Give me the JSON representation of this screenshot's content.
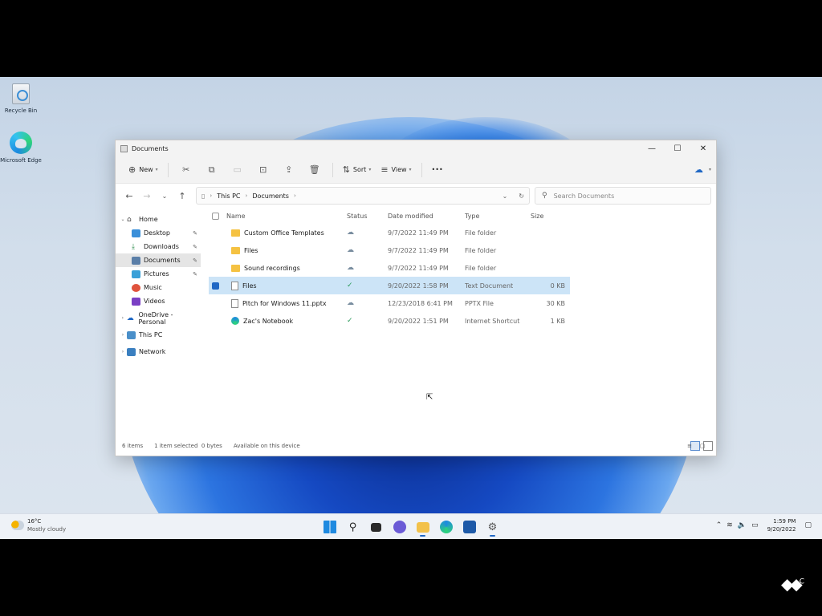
{
  "desktop": {
    "icons": [
      {
        "label": "Recycle Bin",
        "icon": "recycle-bin-icon"
      },
      {
        "label": "Microsoft Edge",
        "icon": "edge-icon"
      }
    ]
  },
  "window": {
    "title": "Documents",
    "toolbar": {
      "new_label": "New",
      "sort_label": "Sort",
      "view_label": "View",
      "more_label": "•••"
    },
    "address": {
      "crumbs": [
        "This PC",
        "Documents"
      ]
    },
    "search_placeholder": "Search Documents",
    "nav": {
      "items": [
        {
          "label": "Home"
        },
        {
          "label": "Desktop"
        },
        {
          "label": "Downloads"
        },
        {
          "label": "Documents"
        },
        {
          "label": "Pictures"
        },
        {
          "label": "Music"
        },
        {
          "label": "Videos"
        },
        {
          "label": "OneDrive - Personal"
        },
        {
          "label": "This PC"
        },
        {
          "label": "Network"
        }
      ]
    },
    "columns": {
      "name": "Name",
      "status": "Status",
      "date": "Date modified",
      "type": "Type",
      "size": "Size"
    },
    "files": [
      {
        "name": "Custom Office Templates",
        "status": "☁",
        "date": "9/7/2022 11:49 PM",
        "type": "File folder",
        "size": ""
      },
      {
        "name": "Files",
        "status": "☁",
        "date": "9/7/2022 11:49 PM",
        "type": "File folder",
        "size": ""
      },
      {
        "name": "Sound recordings",
        "status": "☁",
        "date": "9/7/2022 11:49 PM",
        "type": "File folder",
        "size": ""
      },
      {
        "name": "Files",
        "status": "✓",
        "date": "9/20/2022 1:58 PM",
        "type": "Text Document",
        "size": "0 KB"
      },
      {
        "name": "Pitch for Windows 11.pptx",
        "status": "☁",
        "date": "12/23/2018 6:41 PM",
        "type": "PPTX File",
        "size": "30 KB"
      },
      {
        "name": "Zac's Notebook",
        "status": "✓",
        "date": "9/20/2022 1:51 PM",
        "type": "Internet Shortcut",
        "size": "1 KB"
      }
    ],
    "status_bar": {
      "items_count": "6 items",
      "selected": "1 item selected  0 bytes",
      "availability": "Available on this device"
    }
  },
  "taskbar": {
    "weather_temp": "16°C",
    "weather_condition": "Mostly cloudy",
    "time": "1:59 PM",
    "date": "9/20/2022",
    "accent": "#1f67c4"
  },
  "watermark": "C"
}
